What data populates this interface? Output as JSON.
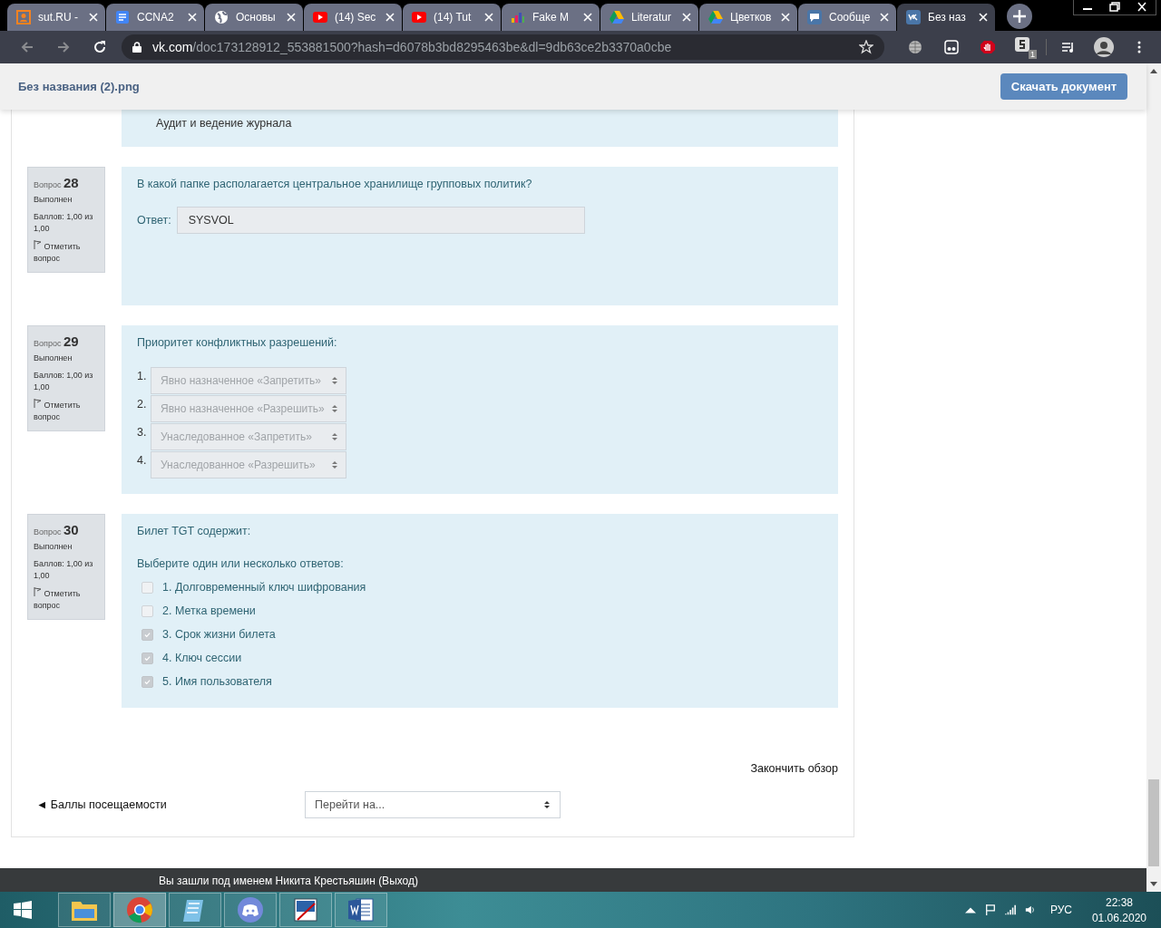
{
  "browser": {
    "tabs": [
      {
        "title": "sut.RU -",
        "kind": "person",
        "selected": false
      },
      {
        "title": "CCNA2",
        "kind": "doc",
        "selected": false
      },
      {
        "title": "Основы",
        "kind": "globe",
        "selected": false
      },
      {
        "title": "(14) Sec",
        "kind": "video",
        "selected": false
      },
      {
        "title": "(14) Tut",
        "kind": "video",
        "selected": false
      },
      {
        "title": "Fake M",
        "kind": "bars",
        "selected": false
      },
      {
        "title": "Literatur",
        "kind": "drive",
        "selected": false
      },
      {
        "title": "Цветков",
        "kind": "drive",
        "selected": false
      },
      {
        "title": "Сообще",
        "kind": "chat",
        "selected": false
      },
      {
        "title": "Без наз",
        "kind": "vk",
        "selected": true
      }
    ],
    "address": {
      "host": "vk.com",
      "path": "/doc173128912_553881500?hash=d6078b3bd8295463be&dl=9db63ce2b3370a0cbe"
    },
    "extension_badge": "1"
  },
  "doc_header": {
    "title": "Без названия (2).png",
    "download_button": "Скачать документ"
  },
  "quiz": {
    "partial_answer": "Аудит и ведение журнала",
    "questions": [
      {
        "label": "Вопрос",
        "number": "28",
        "state": "Выполнен",
        "grade": "Баллов: 1,00 из 1,00",
        "flag": "Отметить вопрос",
        "kind": "short",
        "text": "В какой папке располагается центральное хранилище групповых политик?",
        "answer_label": "Ответ:",
        "answer": "SYSVOL"
      },
      {
        "label": "Вопрос",
        "number": "29",
        "state": "Выполнен",
        "grade": "Баллов: 1,00 из 1,00",
        "flag": "Отметить вопрос",
        "kind": "order",
        "text": "Приоритет конфликтных разрешений:",
        "items": [
          {
            "index": "1.",
            "value": "Явно назначенное «Запретить»"
          },
          {
            "index": "2.",
            "value": "Явно назначенное «Разрешить»"
          },
          {
            "index": "3.",
            "value": "Унаследованное «Запретить»"
          },
          {
            "index": "4.",
            "value": "Унаследованное «Разрешить»"
          }
        ]
      },
      {
        "label": "Вопрос",
        "number": "30",
        "state": "Выполнен",
        "grade": "Баллов: 1,00 из 1,00",
        "flag": "Отметить вопрос",
        "kind": "multi",
        "text": "Билет TGT содержит:",
        "prompt": "Выберите один или несколько ответов:",
        "options": [
          {
            "label": "1. Долговременный ключ шифрования",
            "checked": false
          },
          {
            "label": "2. Метка времени",
            "checked": false
          },
          {
            "label": "3. Срок жизни билета",
            "checked": true
          },
          {
            "label": "4. Ключ сессии",
            "checked": true
          },
          {
            "label": "5. Имя пользователя",
            "checked": true
          }
        ]
      }
    ],
    "finish_link": "Закончить обзор",
    "prev_link": "◄ Баллы посещаемости",
    "jump_select": "Перейти на..."
  },
  "footer": "Вы зашли под именем Никита Крестьяшин (Выход)",
  "taskbar": {
    "apps": [
      {
        "kind": "folder",
        "selected": false
      },
      {
        "kind": "chrome",
        "selected": true
      },
      {
        "kind": "notepad",
        "selected": false
      },
      {
        "kind": "discord",
        "selected": false
      },
      {
        "kind": "paint",
        "selected": false
      },
      {
        "kind": "word",
        "selected": false
      }
    ],
    "language": "РУС",
    "time": "22:38",
    "date": "01.06.2020"
  }
}
